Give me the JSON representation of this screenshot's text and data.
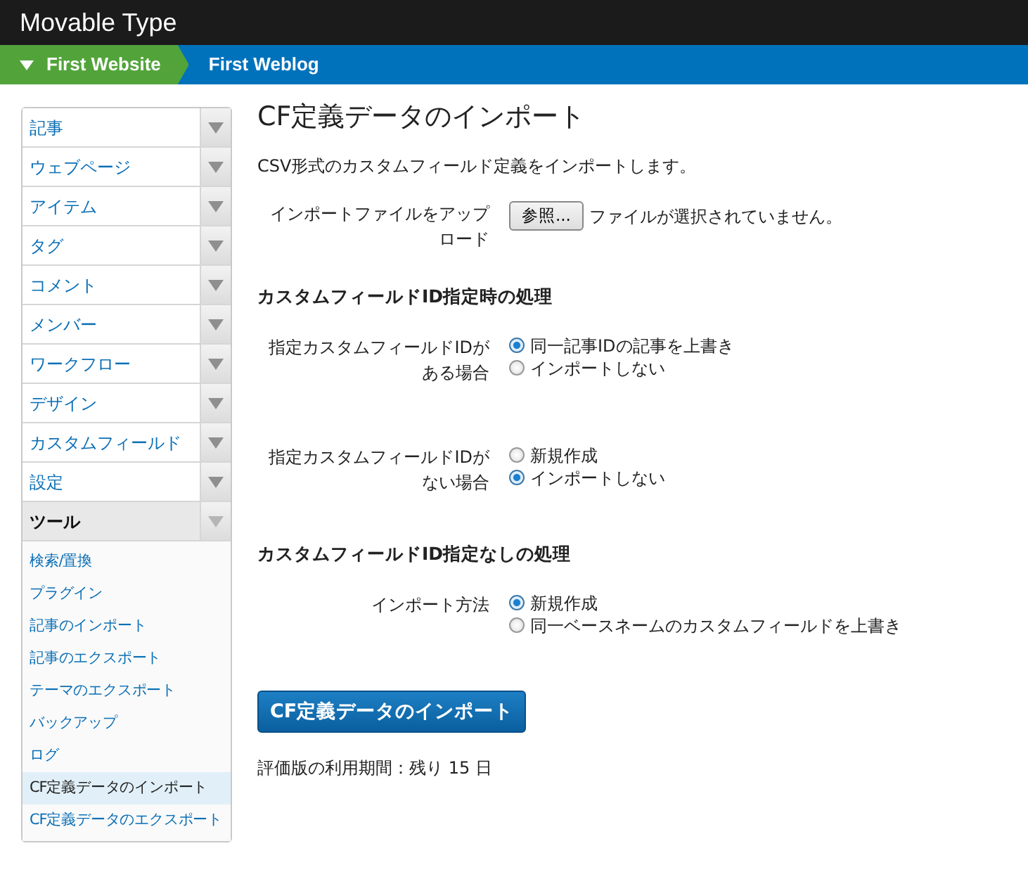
{
  "header": {
    "title": "Movable Type"
  },
  "breadcrumb": [
    {
      "label": "First Website",
      "kind": "website"
    },
    {
      "label": "First Weblog",
      "kind": "blog"
    }
  ],
  "sidebar": {
    "menus": [
      {
        "label": "記事",
        "expanded": false
      },
      {
        "label": "ウェブページ",
        "expanded": false
      },
      {
        "label": "アイテム",
        "expanded": false
      },
      {
        "label": "タグ",
        "expanded": false
      },
      {
        "label": "コメント",
        "expanded": false
      },
      {
        "label": "メンバー",
        "expanded": false
      },
      {
        "label": "ワークフロー",
        "expanded": false
      },
      {
        "label": "デザイン",
        "expanded": false
      },
      {
        "label": "カスタムフィールド",
        "expanded": false
      },
      {
        "label": "設定",
        "expanded": false
      },
      {
        "label": "ツール",
        "expanded": true,
        "children": [
          {
            "label": "検索/置換",
            "selected": false
          },
          {
            "label": "プラグイン",
            "selected": false
          },
          {
            "label": "記事のインポート",
            "selected": false
          },
          {
            "label": "記事のエクスポート",
            "selected": false
          },
          {
            "label": "テーマのエクスポート",
            "selected": false
          },
          {
            "label": "バックアップ",
            "selected": false
          },
          {
            "label": "ログ",
            "selected": false
          },
          {
            "label": "CF定義データのインポート",
            "selected": true
          },
          {
            "label": "CF定義データのエクスポート",
            "selected": false
          }
        ]
      }
    ]
  },
  "content": {
    "title": "CF定義データのインポート",
    "description": "CSV形式のカスタムフィールド定義をインポートします。",
    "upload": {
      "label": "インポートファイルをアップロード",
      "button": "参照...",
      "status": "ファイルが選択されていません。"
    },
    "sections": [
      {
        "heading": "カスタムフィールドID指定時の処理",
        "groups": [
          {
            "label": "指定カスタムフィールドIDがある場合",
            "options": [
              {
                "label": "同一記事IDの記事を上書き",
                "selected": true
              },
              {
                "label": "インポートしない",
                "selected": false
              }
            ]
          },
          {
            "label": "指定カスタムフィールドIDがない場合",
            "options": [
              {
                "label": "新規作成",
                "selected": false
              },
              {
                "label": "インポートしない",
                "selected": true
              }
            ]
          }
        ]
      },
      {
        "heading": "カスタムフィールドID指定なしの処理",
        "groups": [
          {
            "label": "インポート方法",
            "options": [
              {
                "label": "新規作成",
                "selected": true
              },
              {
                "label": "同一ベースネームのカスタムフィールドを上書き",
                "selected": false
              }
            ]
          }
        ]
      }
    ],
    "submit": "CF定義データのインポート",
    "trial_note": "評価版の利用期間：残り 15 日"
  }
}
